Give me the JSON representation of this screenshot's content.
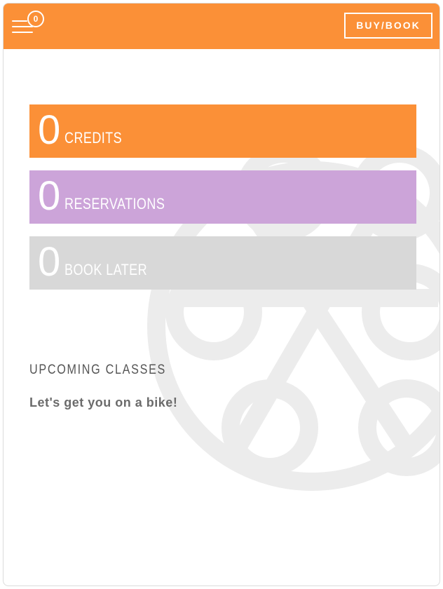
{
  "header": {
    "menu_badge_count": "0",
    "buy_book_label": "BUY/BOOK"
  },
  "stats": [
    {
      "value": "0",
      "label": "CREDITS",
      "color": "#fb9037"
    },
    {
      "value": "0",
      "label": "RESERVATIONS",
      "color": "#cca4d9"
    },
    {
      "value": "0",
      "label": "BOOK LATER",
      "color": "#d8d8d8"
    }
  ],
  "upcoming": {
    "title": "UPCOMING CLASSES",
    "empty_message": "Let's get you on a bike!"
  },
  "colors": {
    "accent": "#fb9037",
    "reservations": "#cca4d9",
    "book_later": "#d8d8d8",
    "watermark": "#ececec"
  },
  "icons": {
    "menu": "menu-icon",
    "watermark": "bike-wheel-watermark"
  }
}
